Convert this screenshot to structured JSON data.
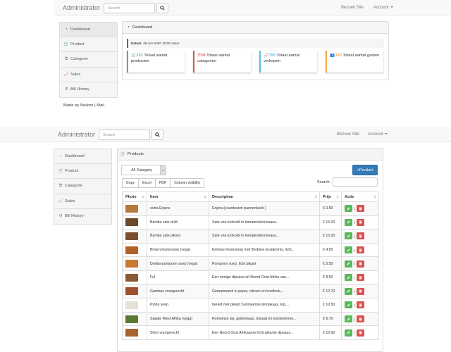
{
  "top": {
    "brand": "Administrator",
    "search_placeholder": "Search",
    "visit_site": "Bezoek Site",
    "account": "Account",
    "sidebar": [
      "Dashboard",
      "Product",
      "Categorie",
      "Sales",
      "Bill History"
    ],
    "footer": "Made by Navbro | Mail",
    "panel_title": "Dashboard",
    "date_label": "Datum:",
    "date_value": "29-Jun-2020 10:06:14am",
    "stats": [
      {
        "value": "121",
        "label": "Totaal aantal producten",
        "color": "#5cb85c"
      },
      {
        "value": "10",
        "label": "Totaal aantal categorien",
        "color": "#d9534f"
      },
      {
        "value": "700",
        "label": "Totaal aantal verkopen",
        "color": "#5bc0de"
      },
      {
        "value": "320",
        "label": "Totaal aantal gasten",
        "color": "#f0ad4e"
      }
    ]
  },
  "bottom": {
    "brand": "Administrator",
    "search_placeholder": "Search",
    "visit_site": "Bezoek Site",
    "account": "Account",
    "sidebar": [
      "Dashboard",
      "Product",
      "Categorie",
      "Sales",
      "Bill History"
    ],
    "panel_title": "Products",
    "category_select": "All Category",
    "add_button": "+Product",
    "export_buttons": [
      "Copy",
      "Excel",
      "PDF",
      "Column visibility"
    ],
    "search_label": "Search:",
    "columns": [
      "Photo",
      "Item",
      "Description",
      "Prijs",
      "Actie"
    ],
    "rows": [
      {
        "item": "extra Enjera",
        "desc": "Enjera (zuurdesem pannenkoek )",
        "price": "€ 0.50",
        "photo": "#b57a3c"
      },
      {
        "item": "Bamba sate mild",
        "desc": "Sate van krokodil in tomaten/kerriesaus...",
        "price": "€ 15.00",
        "photo": "#6b4a2b"
      },
      {
        "item": "Bamba sate pikant",
        "desc": "Sate van krokodil in tomaten/kerriesaus...",
        "price": "€ 15.00",
        "photo": "#7a4e2e"
      },
      {
        "item": "Birsen-linzensoep (vega)",
        "desc": "Eritrese linzensoep met Berbere kruidenmix, licht...",
        "price": "€ 4.50",
        "photo": "#b0622a"
      },
      {
        "item": "Doeba-pompoen soep (vega)",
        "desc": "Pompoen soep, licht pikant",
        "price": "€ 5.50",
        "photo": "#c9782f"
      },
      {
        "item": "Ful",
        "desc": "Een romige dipsaus uit Noord Oost Afrika van...",
        "price": "€ 8.50",
        "photo": "#8a5a33"
      },
      {
        "item": "Gambas voorgerecht",
        "desc": "Gemarineerd in peper, citroen en knoflook,...",
        "price": "€ 12.70",
        "photo": "#a04e2c"
      },
      {
        "item": "Pinda soep",
        "desc": "bereid met pikant Surinaamse pindakaas, kip,...",
        "price": "€ 10.50",
        "photo": "#e6e0d8"
      },
      {
        "item": "Salade West Afrika (vega)",
        "desc": "Romeinse sla, geitenkaas, tomaat en komkommer...",
        "price": "€ 6.70",
        "photo": "#5a7a33"
      },
      {
        "item": "Shiro voorgerecht",
        "desc": "Een Noord Oost Afrikaanse licht pikante dipsaus...",
        "price": "€ 10.50",
        "photo": "#a7642e"
      }
    ]
  }
}
